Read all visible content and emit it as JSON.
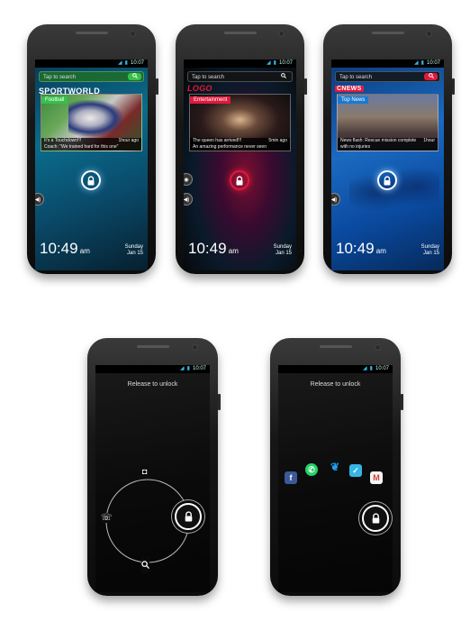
{
  "status": {
    "time": "10:07"
  },
  "lockscreens": [
    {
      "theme": "sport",
      "search_placeholder": "Tap to search",
      "brand": "SPORTWORLD",
      "tag": "Football",
      "headline_line1": "It's a Touchdown!!!",
      "headline_line2": "Coach: \"We trained hard for this one\"",
      "ago": "1hour ago",
      "clock": "10:49",
      "ampm": "am",
      "day": "Sunday",
      "date": "Jan 15",
      "accent": "#35c04a"
    },
    {
      "theme": "entertainment",
      "search_placeholder": "Tap to search",
      "brand": "LOGO",
      "tag": "Entertainment",
      "headline_line1": "The queen has arrived!!!",
      "headline_line2": "An amazing performance never seen",
      "ago": "5min ago",
      "clock": "10:49",
      "ampm": "am",
      "day": "Sunday",
      "date": "Jan 15",
      "accent": "#e01a3c"
    },
    {
      "theme": "news",
      "search_placeholder": "Tap to search",
      "brand": "CNEWS",
      "tag": "Top News",
      "headline_line1": "News flash: Rescue mission complete",
      "headline_line2": "with no injuries",
      "ago": "1hour",
      "clock": "10:49",
      "ampm": "am",
      "day": "Sunday",
      "date": "Jan 15",
      "accent": "#e01a3c"
    }
  ],
  "unlock_screens": [
    {
      "instruction": "Release to unlock"
    },
    {
      "instruction": "Release to unlock"
    }
  ],
  "share_icons": [
    "facebook-icon",
    "whatsapp-icon",
    "twitter-icon",
    "foursquare-icon",
    "gmail-icon"
  ]
}
